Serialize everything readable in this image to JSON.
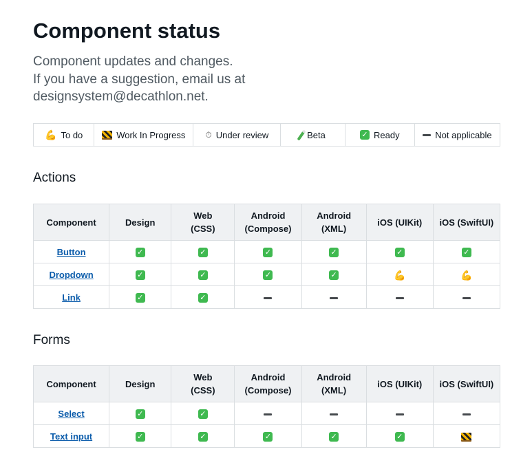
{
  "title": "Component status",
  "intro": [
    "Component updates and changes.",
    "If you have a suggestion, email us at",
    "designsystem@decathlon.net."
  ],
  "legend": [
    {
      "icon": "flexed-biceps-icon",
      "label": "To do"
    },
    {
      "icon": "construction-icon",
      "label": "Work In Progress"
    },
    {
      "icon": "stopwatch-icon",
      "label": "Under review"
    },
    {
      "icon": "test-tube-icon",
      "label": "Beta"
    },
    {
      "icon": "check-mark-icon",
      "label": "Ready"
    },
    {
      "icon": "minus-icon",
      "label": "Not applicable"
    }
  ],
  "columns": [
    "Component",
    "Design",
    "Web (CSS)",
    "Android (Compose)",
    "Android (XML)",
    "iOS (UIKit)",
    "iOS (SwiftUI)"
  ],
  "sections": [
    {
      "title": "Actions",
      "rows": [
        {
          "name": "Button",
          "status": [
            "ready",
            "ready",
            "ready",
            "ready",
            "ready",
            "ready"
          ]
        },
        {
          "name": "Dropdown",
          "status": [
            "ready",
            "ready",
            "ready",
            "ready",
            "todo",
            "todo"
          ]
        },
        {
          "name": "Link",
          "status": [
            "ready",
            "ready",
            "na",
            "na",
            "na",
            "na"
          ]
        }
      ]
    },
    {
      "title": "Forms",
      "rows": [
        {
          "name": "Select",
          "status": [
            "ready",
            "ready",
            "na",
            "na",
            "na",
            "na"
          ]
        },
        {
          "name": "Text input",
          "status": [
            "ready",
            "ready",
            "ready",
            "ready",
            "ready",
            "wip"
          ]
        }
      ]
    }
  ]
}
